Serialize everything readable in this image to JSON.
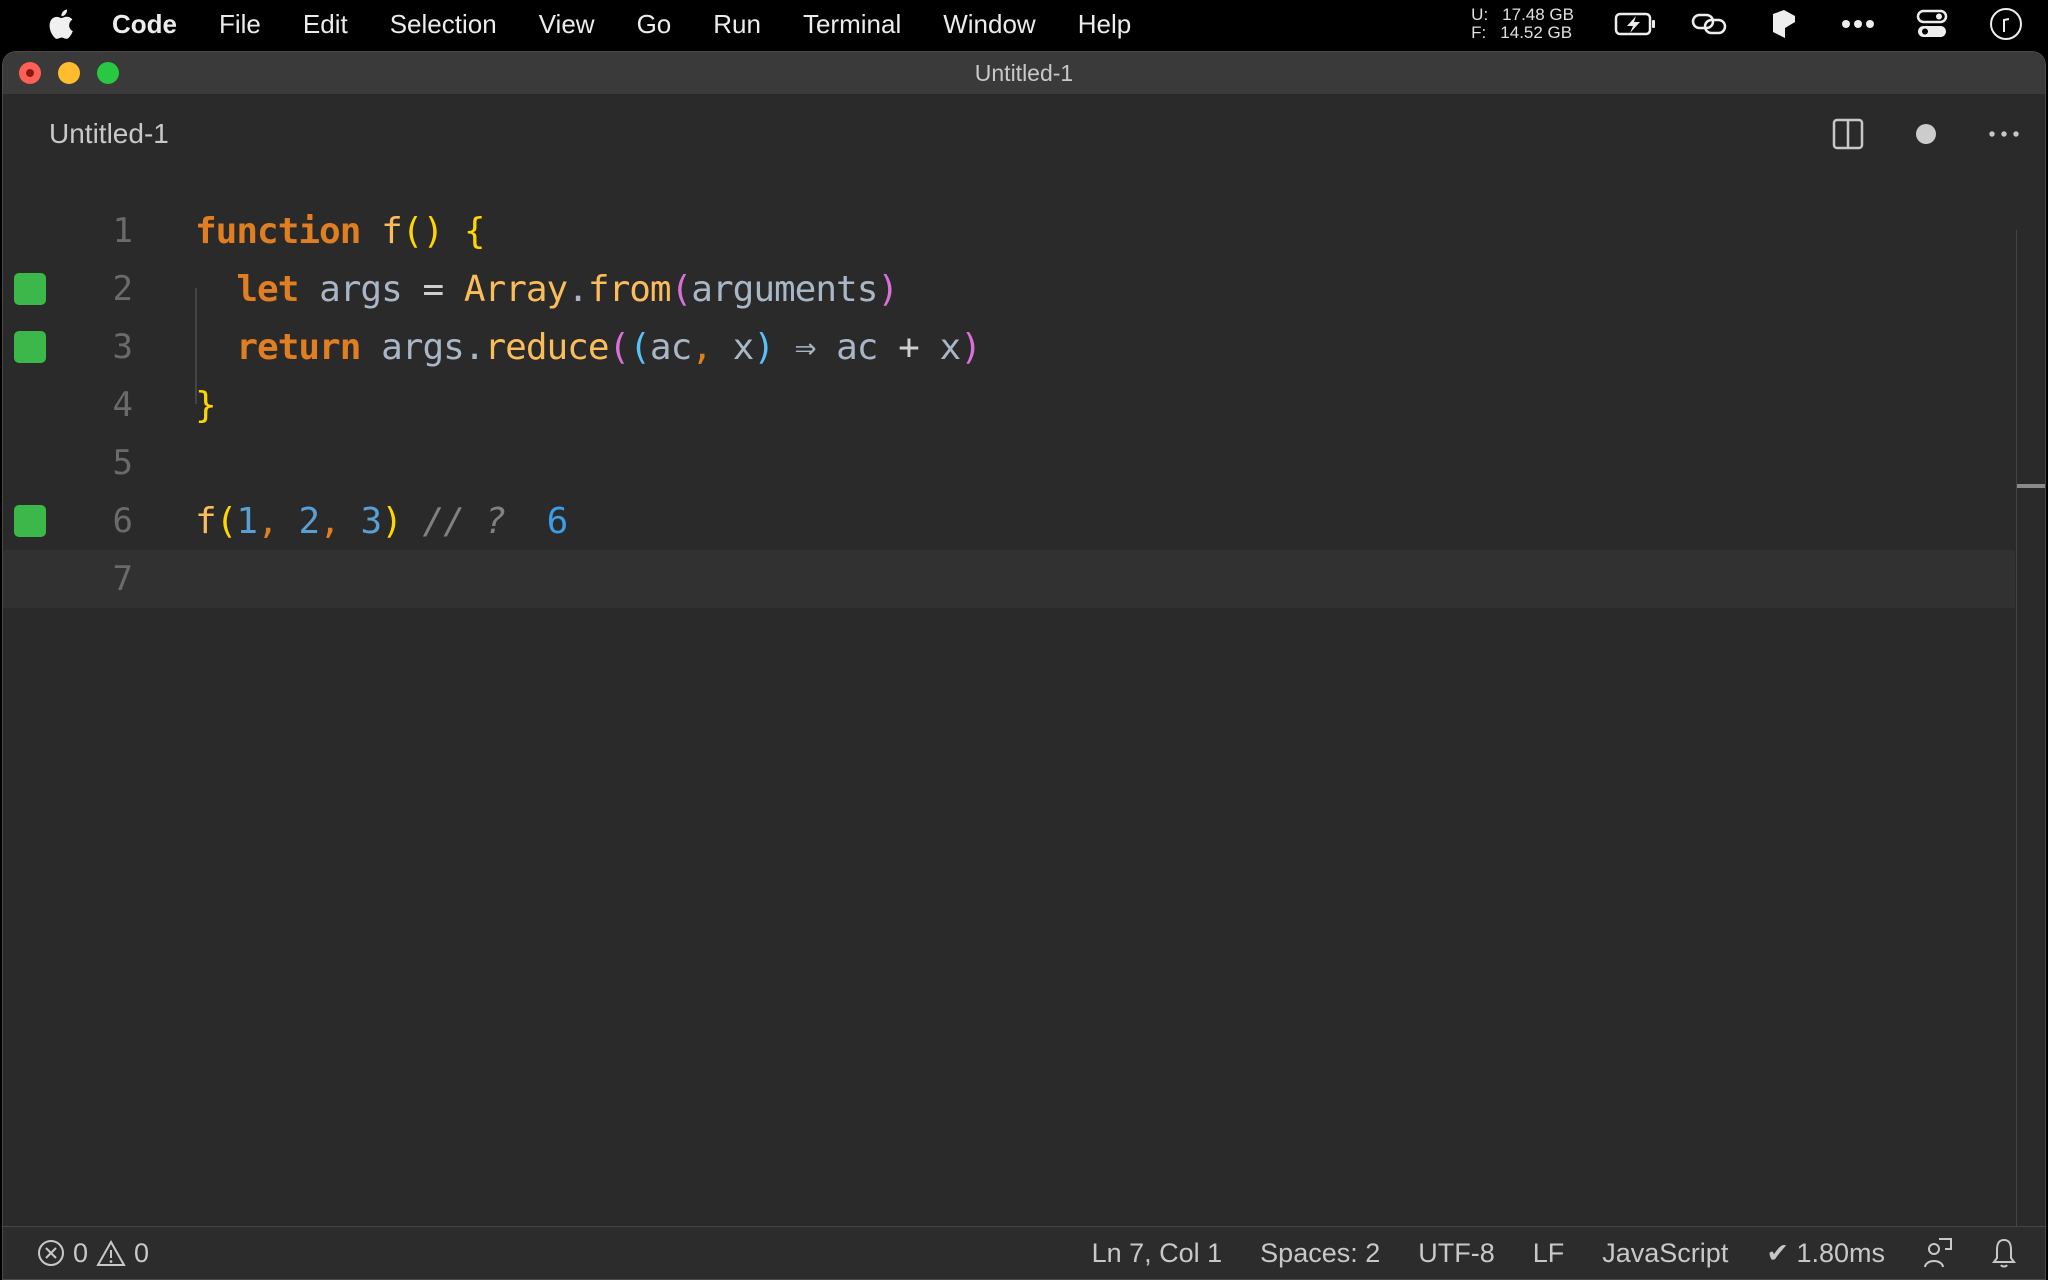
{
  "menubar": {
    "app_name": "Code",
    "items": [
      "File",
      "Edit",
      "Selection",
      "View",
      "Go",
      "Run",
      "Terminal",
      "Window",
      "Help"
    ],
    "memory": {
      "used_label": "U:",
      "used_value": "17.48 GB",
      "free_label": "F:",
      "free_value": "14.52 GB"
    },
    "tray_icons": [
      "battery-charging-icon",
      "link-icon",
      "cube-icon",
      "more-icon",
      "control-center-icon",
      "clock-icon"
    ]
  },
  "window": {
    "title": "Untitled-1",
    "tab": {
      "label": "Untitled-1",
      "dirty": true
    },
    "tab_actions": [
      "split-editor-icon",
      "unsaved-dot-icon",
      "more-actions-icon"
    ]
  },
  "editor": {
    "cursor_line": 7,
    "lines": [
      {
        "number": "1",
        "marker": false
      },
      {
        "number": "2",
        "marker": true
      },
      {
        "number": "3",
        "marker": true
      },
      {
        "number": "4",
        "marker": false
      },
      {
        "number": "5",
        "marker": false
      },
      {
        "number": "6",
        "marker": true
      },
      {
        "number": "7",
        "marker": false
      }
    ],
    "tokens": {
      "l1": {
        "kw": "function",
        "name": "f",
        "open": "(",
        "close": ")",
        "brace": "{"
      },
      "l2": {
        "kw": "let",
        "var": "args",
        "eq": "=",
        "cls": "Array",
        "dot": ".",
        "method": "from",
        "open": "(",
        "arg": "arguments",
        "close": ")"
      },
      "l3": {
        "kw": "return",
        "var": "args",
        "dot": ".",
        "method": "reduce",
        "open1": "(",
        "open2": "(",
        "p1": "ac",
        "comma": ",",
        "p2": "x",
        "close2": ")",
        "arrow": "⇒",
        "b1": "ac",
        "plus": "+",
        "b2": "x",
        "close1": ")"
      },
      "l4": {
        "brace": "}"
      },
      "l6": {
        "name": "f",
        "open": "(",
        "n1": "1",
        "c1": ",",
        "n2": "2",
        "c2": ",",
        "n3": "3",
        "close": ")",
        "comment": "// ?",
        "result": "6"
      }
    },
    "marker_color": "#3cb84a"
  },
  "statusbar": {
    "errors": "0",
    "warnings": "0",
    "position": "Ln 7, Col 1",
    "indent": "Spaces: 2",
    "encoding": "UTF-8",
    "eol": "LF",
    "language": "JavaScript",
    "timing": "✔ 1.80ms"
  }
}
